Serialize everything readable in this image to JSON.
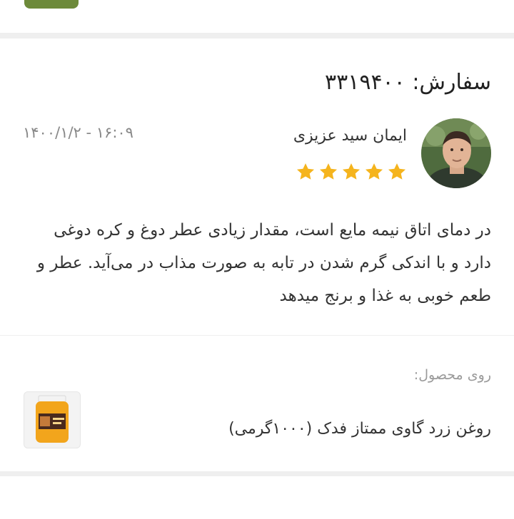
{
  "colors": {
    "page_background": "#efefef",
    "card_background": "#ffffff",
    "star": "#f5b41d",
    "muted_text": "#888888"
  },
  "review": {
    "order_label": "سفارش:",
    "order_number": "۳۳۱۹۴۰۰",
    "reviewer_name": "ایمان سید عزیزی",
    "datetime": "۱۶:۰۹ - ۱۴۰۰/۱/۲",
    "rating": 5,
    "rating_max": 5,
    "avatar_icon": "user-avatar-photo",
    "text": "در دمای اتاق نیمه مایع است، مقدار زیادی عطر دوغ و کره دوغی دارد و با اندکی گرم شدن در تابه به صورت مذاب در می‌آید. عطر و طعم خوبی به غذا و برنج میدهد"
  },
  "product": {
    "on_product_label": "روی محصول:",
    "name": "روغن زرد گاوی ممتاز فدک (۱۰۰۰گرمی)",
    "thumb_icon": "product-jar-image"
  }
}
